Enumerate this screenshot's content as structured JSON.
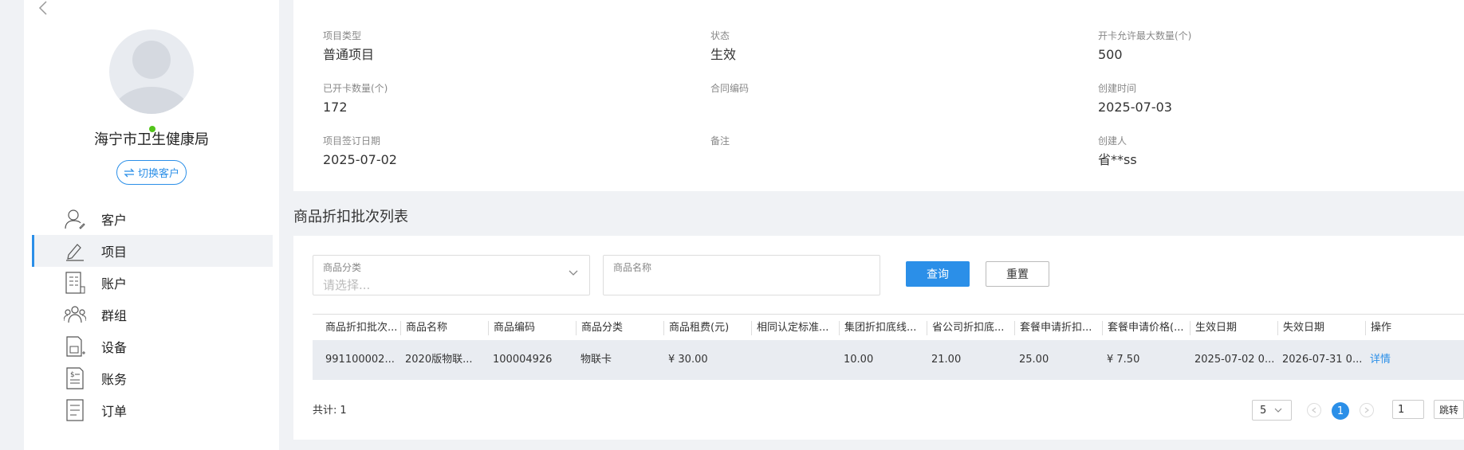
{
  "sidebar": {
    "customer_name": "海宁市卫生健康局",
    "switch_label": "切换客户",
    "items": [
      {
        "label": "客户",
        "icon": "user-icon"
      },
      {
        "label": "项目",
        "icon": "edit-icon"
      },
      {
        "label": "账户",
        "icon": "account-icon"
      },
      {
        "label": "群组",
        "icon": "group-icon"
      },
      {
        "label": "设备",
        "icon": "device-icon"
      },
      {
        "label": "账务",
        "icon": "billing-icon"
      },
      {
        "label": "订单",
        "icon": "order-icon"
      }
    ],
    "active_item": "项目"
  },
  "info": {
    "project_type_label": "项目类型",
    "project_type": "普通项目",
    "status_label": "状态",
    "status": "生效",
    "max_cards_label": "开卡允许最大数量(个)",
    "max_cards": "500",
    "opened_cards_label": "已开卡数量(个)",
    "opened_cards": "172",
    "contract_code_label": "合同编码",
    "contract_code": "",
    "created_time_label": "创建时间",
    "created_time": "2025-07-03",
    "sign_date_label": "项目签订日期",
    "sign_date": "2025-07-02",
    "remark_label": "备注",
    "remark": "",
    "creator_label": "创建人",
    "creator": "省**ss"
  },
  "section_title": "商品折扣批次列表",
  "filters": {
    "category_label": "商品分类",
    "category_placeholder": "请选择...",
    "name_label": "商品名称",
    "name_value": "",
    "query_label": "查询",
    "reset_label": "重置"
  },
  "table": {
    "headers": [
      "商品折扣批次...",
      "商品名称",
      "商品编码",
      "商品分类",
      "商品租费(元)",
      "相同认定标准...",
      "集团折扣底线...",
      "省公司折扣底...",
      "套餐申请折扣...",
      "套餐申请价格(...",
      "生效日期",
      "失效日期",
      "操作"
    ],
    "rows": [
      [
        "991100002...",
        "2020版物联...",
        "100004926",
        "物联卡",
        "¥ 30.00",
        "",
        "10.00",
        "21.00",
        "25.00",
        "¥ 7.50",
        "2025-07-02 0...",
        "2026-07-31 0...",
        "详情"
      ]
    ]
  },
  "pagination": {
    "total_label": "共计:",
    "total": "1",
    "page_size": "5",
    "current_page": "1",
    "jump_value": "1",
    "jump_label": "跳转"
  },
  "colors": {
    "accent": "#2b8fe8",
    "online": "#52c41a",
    "row_bg": "#e9ecf1"
  }
}
